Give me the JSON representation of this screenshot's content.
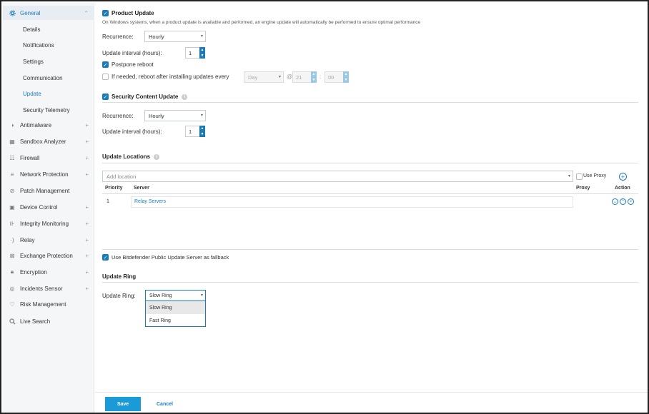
{
  "sidebar": {
    "general": {
      "label": "General",
      "icon": "gear-icon"
    },
    "general_sub": [
      "Details",
      "Notifications",
      "Settings",
      "Communication",
      "Update",
      "Security Telemetry"
    ],
    "active_sub": "Update",
    "modules": [
      {
        "label": "Antimalware",
        "icon": "shield-icon",
        "expandable": true
      },
      {
        "label": "Sandbox Analyzer",
        "icon": "sandbox-icon",
        "expandable": true
      },
      {
        "label": "Firewall",
        "icon": "firewall-icon",
        "expandable": true
      },
      {
        "label": "Network Protection",
        "icon": "network-icon",
        "expandable": true
      },
      {
        "label": "Patch Management",
        "icon": "patch-icon",
        "expandable": false
      },
      {
        "label": "Device Control",
        "icon": "device-icon",
        "expandable": true
      },
      {
        "label": "Integrity Monitoring",
        "icon": "integrity-icon",
        "expandable": true
      },
      {
        "label": "Relay",
        "icon": "relay-icon",
        "expandable": true
      },
      {
        "label": "Exchange Protection",
        "icon": "exchange-icon",
        "expandable": true
      },
      {
        "label": "Encryption",
        "icon": "lock-icon",
        "expandable": true
      },
      {
        "label": "Incidents Sensor",
        "icon": "sensor-icon",
        "expandable": true
      },
      {
        "label": "Risk Management",
        "icon": "risk-icon",
        "expandable": false
      },
      {
        "label": "Live Search",
        "icon": "search-icon",
        "expandable": false
      }
    ]
  },
  "product_update": {
    "title": "Product Update",
    "checked": true,
    "description": "On Windows systems, when a product update is available and performed, an engine update will automatically be performed to ensure optimal performance",
    "recurrence_label": "Recurrence:",
    "recurrence_value": "Hourly",
    "interval_label": "Update interval (hours):",
    "interval_value": "1",
    "postpone_label": "Postpone reboot",
    "postpone_checked": true,
    "reboot_label": "If needed, reboot after installing updates every",
    "reboot_checked": false,
    "reboot_day": "Day",
    "reboot_at": "@",
    "reboot_hour": "21",
    "reboot_sep": ":",
    "reboot_min": "00"
  },
  "security_content": {
    "title": "Security Content Update",
    "checked": true,
    "recurrence_label": "Recurrence:",
    "recurrence_value": "Hourly",
    "interval_label": "Update interval (hours):",
    "interval_value": "1"
  },
  "locations": {
    "title": "Update Locations",
    "add_placeholder": "Add location",
    "use_proxy_label": "Use Proxy",
    "columns": {
      "priority": "Priority",
      "server": "Server",
      "proxy": "Proxy",
      "action": "Action"
    },
    "rows": [
      {
        "priority": "1",
        "server": "Relay Servers",
        "proxy": ""
      }
    ]
  },
  "fallback": {
    "label": "Use Bitdefender Public Update Server as fallback",
    "checked": true
  },
  "update_ring": {
    "title": "Update Ring",
    "label": "Update Ring:",
    "value": "Slow Ring",
    "options": [
      "Slow Ring",
      "Fast Ring"
    ],
    "highlighted": "Slow Ring"
  },
  "footer": {
    "save": "Save",
    "cancel": "Cancel"
  },
  "colors": {
    "accent": "#1a7bb9",
    "save_button": "#1a9bd7"
  }
}
